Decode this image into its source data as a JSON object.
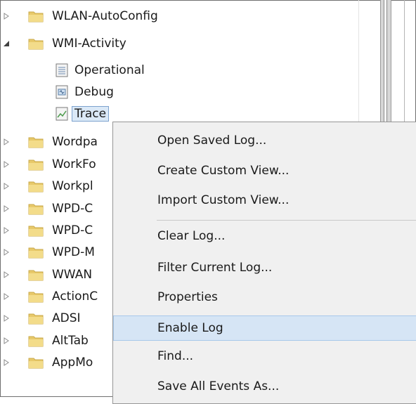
{
  "tree": {
    "items": [
      {
        "label": "WLAN-AutoConfig",
        "expander": "collapsed"
      },
      {
        "label": "WMI-Activity",
        "expander": "expanded"
      },
      {
        "label": "Operational",
        "icon": "log-icon"
      },
      {
        "label": "Debug",
        "icon": "debug-log-icon"
      },
      {
        "label": "Trace",
        "icon": "trace-log-icon",
        "selected": true
      },
      {
        "label": "Wordpa",
        "expander": "collapsed"
      },
      {
        "label": "WorkFo",
        "expander": "collapsed"
      },
      {
        "label": "Workpl",
        "expander": "collapsed"
      },
      {
        "label": "WPD-C",
        "expander": "collapsed"
      },
      {
        "label": "WPD-C",
        "expander": "collapsed"
      },
      {
        "label": "WPD-M",
        "expander": "collapsed"
      },
      {
        "label": "WWAN",
        "expander": "collapsed"
      },
      {
        "label": "ActionC",
        "expander": "collapsed"
      },
      {
        "label": "ADSI",
        "expander": "collapsed"
      },
      {
        "label": "AltTab",
        "expander": "collapsed"
      },
      {
        "label": "AppMo",
        "expander": "collapsed"
      }
    ]
  },
  "context_menu": {
    "items": [
      {
        "label": "Open Saved Log..."
      },
      {
        "label": "Create Custom View..."
      },
      {
        "label": "Import Custom View..."
      },
      {
        "label": "Clear Log..."
      },
      {
        "label": "Filter Current Log..."
      },
      {
        "label": "Properties"
      },
      {
        "label": "Enable Log",
        "highlighted": true
      },
      {
        "label": "Find..."
      },
      {
        "label": "Save All Events As..."
      }
    ]
  },
  "colors": {
    "folder": "#e8c96a",
    "selection_bg": "#dbe9f7",
    "menu_bg": "#f0f0f0",
    "menu_hover": "#d6e5f5"
  }
}
